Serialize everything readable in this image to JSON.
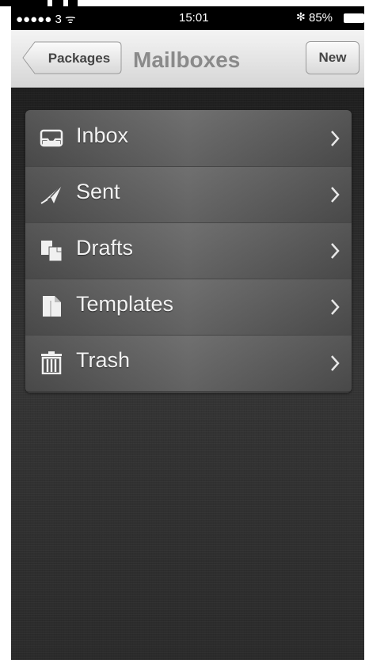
{
  "status_bar": {
    "signal": "●●●●● 3 ᯤ",
    "time": "15:01",
    "bluetooth": "✻",
    "battery_pct": "85%"
  },
  "nav": {
    "back_label": "Packages",
    "title": "Mailboxes",
    "new_label": "New"
  },
  "mailboxes": [
    {
      "label": "Inbox",
      "icon": "inbox-tray-icon"
    },
    {
      "label": "Sent",
      "icon": "paper-plane-icon"
    },
    {
      "label": "Drafts",
      "icon": "drafts-documents-icon"
    },
    {
      "label": "Templates",
      "icon": "template-document-icon"
    },
    {
      "label": "Trash",
      "icon": "trash-can-icon"
    }
  ],
  "colors": {
    "background": "#2a2a2a",
    "row_light": "#676767",
    "row_dark": "#4c4c4c",
    "navbar_top": "#f4f4f4",
    "navbar_bottom": "#d6d6d6"
  }
}
